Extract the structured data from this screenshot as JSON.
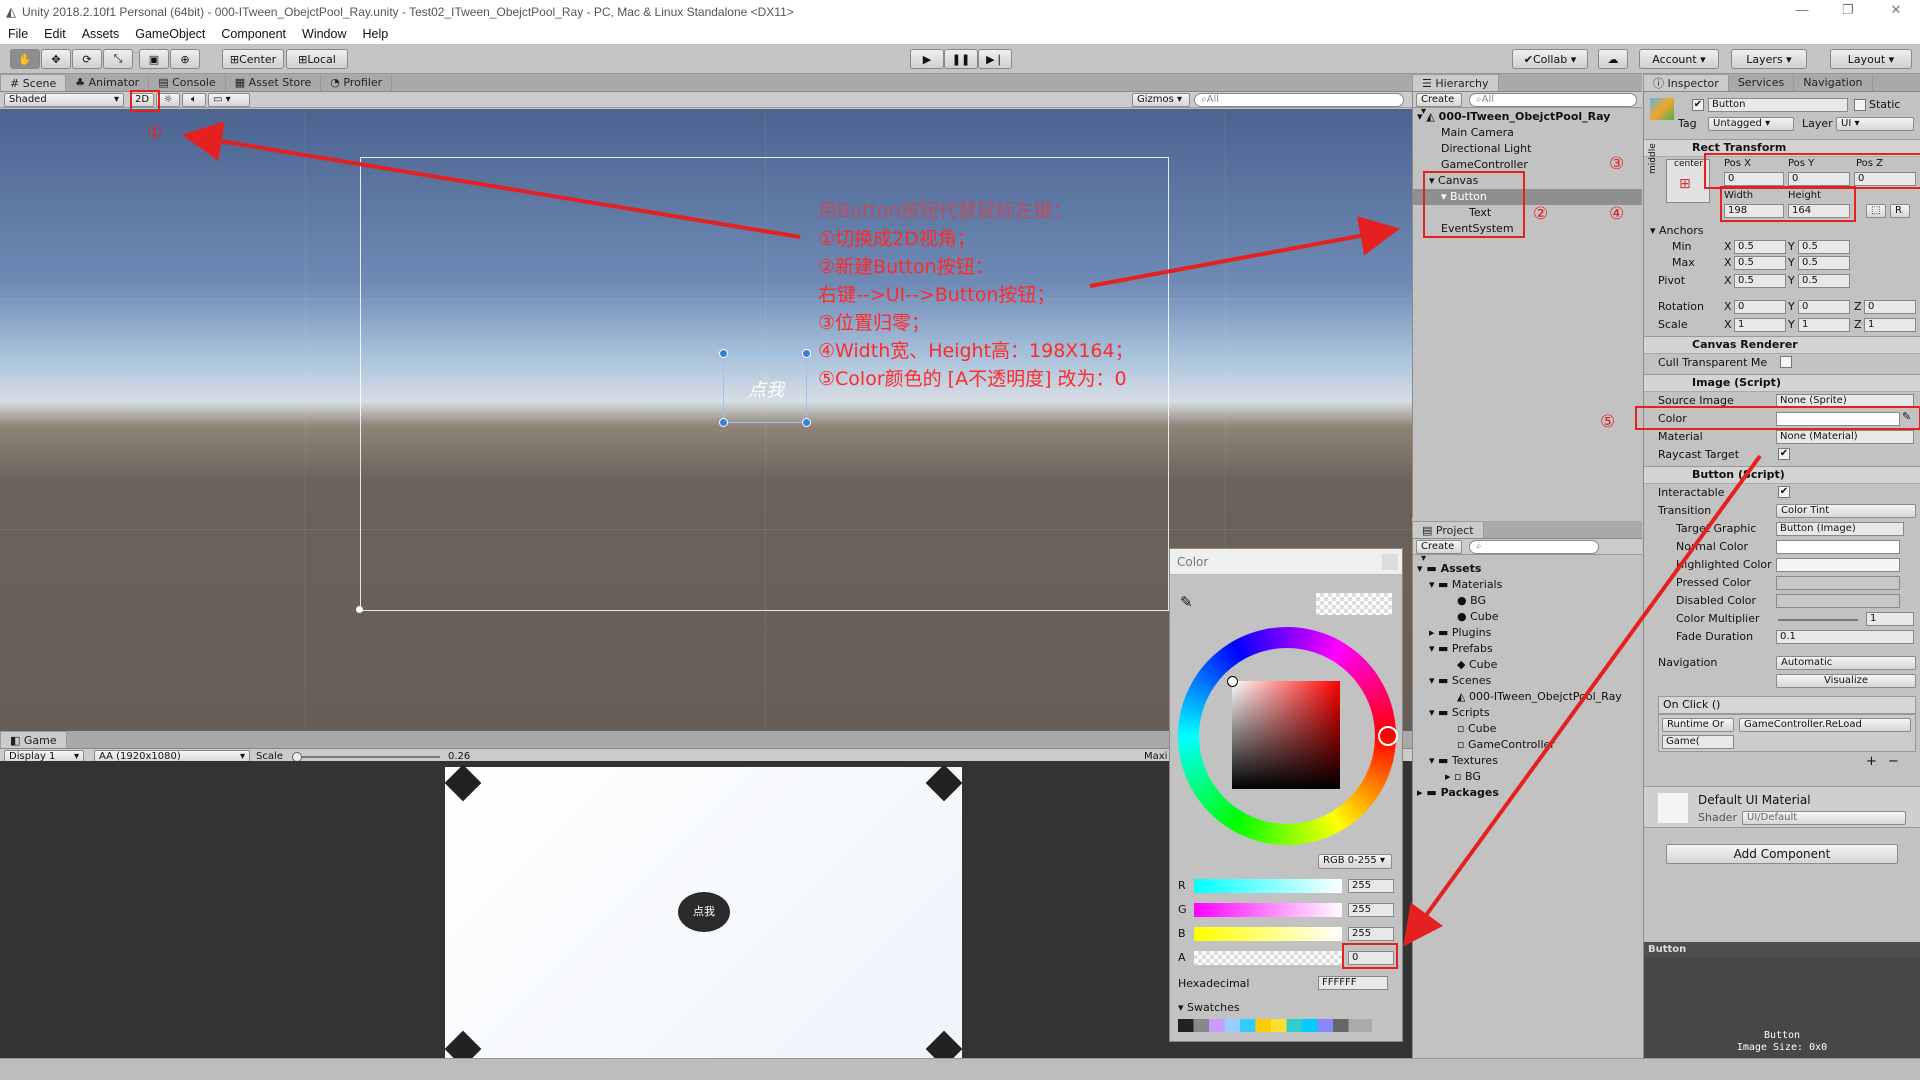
{
  "window": {
    "title": "Unity 2018.2.10f1 Personal (64bit) - 000-ITween_ObejctPool_Ray.unity - Test02_ITween_ObejctPool_Ray - PC, Mac & Linux Standalone <DX11>"
  },
  "menu": [
    "File",
    "Edit",
    "Assets",
    "GameObject",
    "Component",
    "Window",
    "Help"
  ],
  "toolbar": {
    "pivot": "Center",
    "space": "Local",
    "collab": "Collab",
    "account": "Account",
    "layers": "Layers",
    "layout": "Layout"
  },
  "scene_tabs": [
    "Scene",
    "Animator",
    "Console",
    "Asset Store",
    "Profiler"
  ],
  "scene_bar": {
    "shading": "Shaded",
    "mode2d": "2D",
    "gizmos": "Gizmos",
    "search": "All"
  },
  "scene_button_text": "点我",
  "game": {
    "tab": "Game",
    "display": "Display 1",
    "resolution": "AA (1920x1080)",
    "scale_label": "Scale",
    "scale_value": "0.26",
    "maximize": "Maxi",
    "button_text": "点我"
  },
  "hierarchy": {
    "tab": "Hierarchy",
    "create": "Create",
    "search": "All",
    "scene": "000-ITween_ObejctPool_Ray",
    "items": [
      "Main Camera",
      "Directional Light",
      "GameController",
      "Canvas",
      "Button",
      "Text",
      "EventSystem"
    ]
  },
  "project": {
    "tab": "Project",
    "create": "Create",
    "items": [
      "Assets",
      "Materials",
      "BG",
      "Cube",
      "Plugins",
      "Prefabs",
      "Cube",
      "Scenes",
      "000-ITween_ObejctPool_Ray",
      "Scripts",
      "Cube",
      "GameController",
      "Textures",
      "BG",
      "Packages"
    ]
  },
  "inspector": {
    "tabs": [
      "Inspector",
      "Services",
      "Navigation"
    ],
    "name": "Button",
    "static": "Static",
    "tag_label": "Tag",
    "tag": "Untagged",
    "layer_label": "Layer",
    "layer": "UI",
    "rect": {
      "title": "Rect Transform",
      "anchor_h": "center",
      "anchor_v": "middle",
      "posx_label": "Pos X",
      "posy_label": "Pos Y",
      "posz_label": "Pos Z",
      "posx": "0",
      "posy": "0",
      "posz": "0",
      "width_label": "Width",
      "height_label": "Height",
      "width": "198",
      "height": "164",
      "anchors": "Anchors",
      "min": "Min",
      "max": "Max",
      "pivot": "Pivot",
      "min_x": "0.5",
      "min_y": "0.5",
      "max_x": "0.5",
      "max_y": "0.5",
      "pivot_x": "0.5",
      "pivot_y": "0.5",
      "rotation": "Rotation",
      "scale": "Scale",
      "rot": [
        "0",
        "0",
        "0"
      ],
      "scl": [
        "1",
        "1",
        "1"
      ]
    },
    "canvas_renderer": {
      "title": "Canvas Renderer",
      "cull": "Cull Transparent Me"
    },
    "image": {
      "title": "Image (Script)",
      "source_label": "Source Image",
      "source": "None (Sprite)",
      "color_label": "Color",
      "material_label": "Material",
      "material": "None (Material)",
      "raycast": "Raycast Target"
    },
    "button": {
      "title": "Button (Script)",
      "interactable": "Interactable",
      "transition_label": "Transition",
      "transition": "Color Tint",
      "target_label": "Target Graphic",
      "target": "Button (Image)",
      "normal": "Normal Color",
      "highlighted": "Highlighted Color",
      "pressed": "Pressed Color",
      "disabled": "Disabled Color",
      "multiplier_label": "Color Multiplier",
      "multiplier": "1",
      "fade_label": "Fade Duration",
      "fade": "0.1",
      "navigation_label": "Navigation",
      "navigation": "Automatic",
      "visualize": "Visualize",
      "onclick": "On Click ()",
      "runtime": "Runtime Or",
      "function": "GameController.ReLoad",
      "object": "Game("
    },
    "material": {
      "title": "Default UI Material",
      "shader_label": "Shader",
      "shader": "UI/Default"
    },
    "add_component": "Add Component",
    "preview_title": "Button",
    "preview_name": "Button",
    "preview_size": "Image Size: 0x0"
  },
  "color_picker": {
    "title": "Color",
    "mode": "RGB 0-255",
    "channels": [
      {
        "label": "R",
        "value": "255"
      },
      {
        "label": "G",
        "value": "255"
      },
      {
        "label": "B",
        "value": "255"
      },
      {
        "label": "A",
        "value": "0"
      }
    ],
    "hex_label": "Hexadecimal",
    "hex": "FFFFFF",
    "swatches": "Swatches"
  },
  "annotation": {
    "lines": [
      "用Button按钮代替鼠标左键：",
      "①切换成2D视角；",
      "②新建Button按钮：",
      "右键-->UI-->Button按钮；",
      "③位置归零；",
      "④Width宽、Height高：198X164；",
      "⑤Color颜色的 [A不透明度] 改为：0"
    ],
    "markers": [
      "①",
      "②",
      "③",
      "④",
      "⑤"
    ]
  },
  "colors": {
    "annotation": "#ff2a2a",
    "selection": "#8f8f8f",
    "panel": "#c2c2c2"
  }
}
